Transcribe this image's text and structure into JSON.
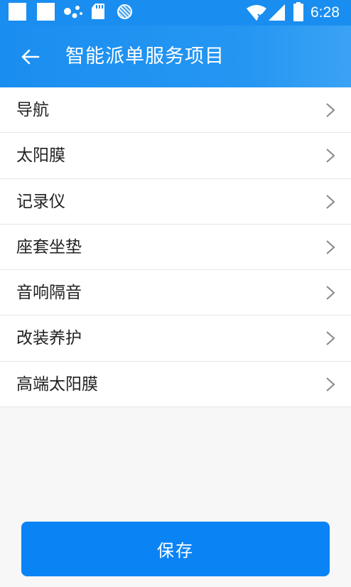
{
  "status_bar": {
    "time": "6:28",
    "icons": [
      "notification-square-icon",
      "notification-square-icon",
      "assistant-dots-icon",
      "sd-card-icon",
      "sync-circle-icon",
      "wifi-icon",
      "signal-icon",
      "battery-icon"
    ]
  },
  "header": {
    "title": "智能派单服务项目",
    "back_icon": "arrow-left-icon"
  },
  "services": [
    {
      "label": "导航"
    },
    {
      "label": "太阳膜"
    },
    {
      "label": "记录仪"
    },
    {
      "label": "座套坐垫"
    },
    {
      "label": "音响隔音"
    },
    {
      "label": "改装养护"
    },
    {
      "label": "高端太阳膜"
    }
  ],
  "footer": {
    "save_label": "保存"
  },
  "colors": {
    "primary": "#1a8ef0",
    "button": "#0a84f5",
    "background": "#f7f7f7",
    "text": "#222222",
    "chevron": "#888888"
  }
}
